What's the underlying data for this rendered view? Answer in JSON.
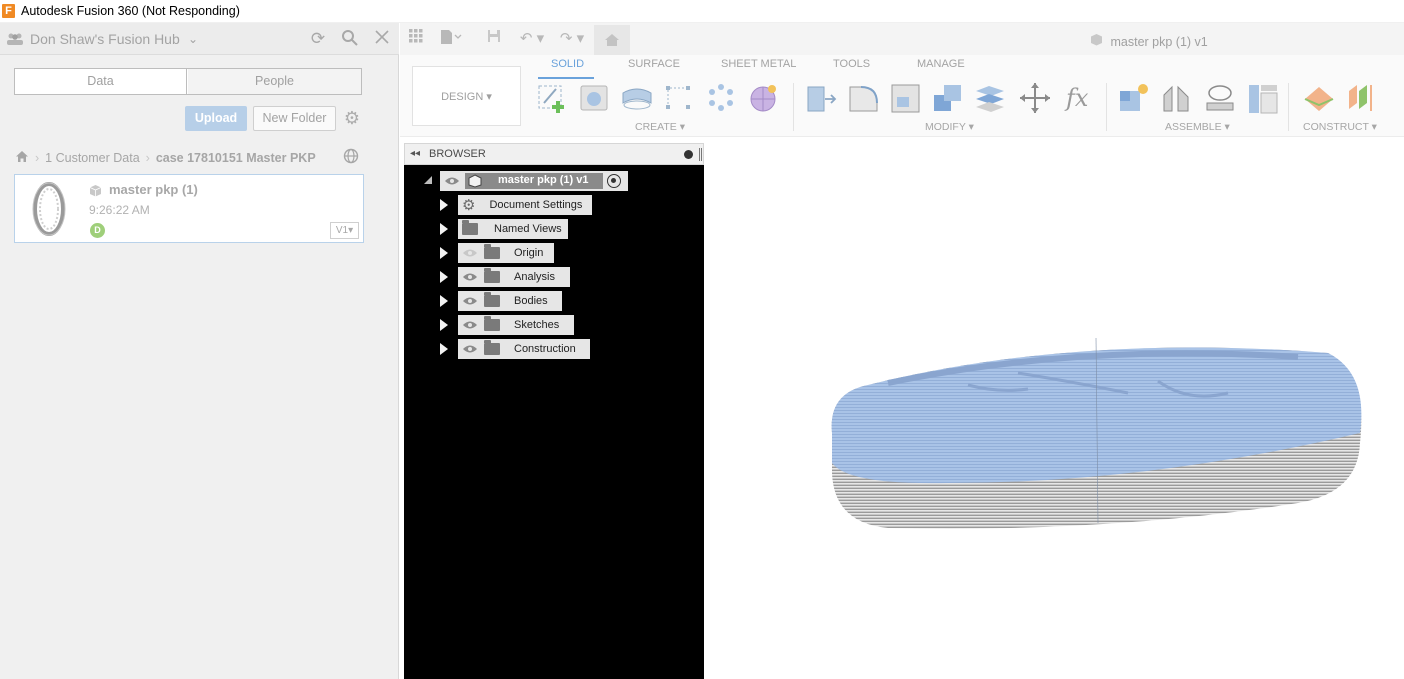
{
  "window": {
    "title": "Autodesk Fusion 360 (Not Responding)"
  },
  "data_panel": {
    "hub_name": "Don Shaw's Fusion Hub",
    "tabs": [
      {
        "label": "Data"
      },
      {
        "label": "People"
      }
    ],
    "upload_label": "Upload",
    "new_folder_label": "New Folder",
    "breadcrumb": [
      "1 Customer Data",
      "case 17810151 Master PKP"
    ],
    "files": [
      {
        "name": "master pkp (1)",
        "time": "9:26:22 AM",
        "avatar": "D",
        "version": "V1"
      }
    ]
  },
  "document": {
    "title": "master pkp (1) v1"
  },
  "toolbar": {
    "workspace": "DESIGN",
    "tabs": [
      "SOLID",
      "SURFACE",
      "SHEET METAL",
      "TOOLS",
      "MANAGE"
    ],
    "active_tab": "SOLID",
    "groups": [
      "CREATE",
      "MODIFY",
      "ASSEMBLE",
      "CONSTRUCT"
    ]
  },
  "browser": {
    "header": "BROWSER",
    "root": "master pkp (1) v1",
    "items": [
      {
        "label": "Document Settings",
        "icon": "gear-icon"
      },
      {
        "label": "Named Views",
        "icon": "folder-icon"
      },
      {
        "label": "Origin",
        "icon": "folder-icon"
      },
      {
        "label": "Analysis",
        "icon": "folder-icon"
      },
      {
        "label": "Bodies",
        "icon": "folder-icon"
      },
      {
        "label": "Sketches",
        "icon": "folder-icon"
      },
      {
        "label": "Construction",
        "icon": "folder-icon"
      }
    ]
  },
  "colors": {
    "accent": "#6aa2db",
    "upload_button": "#b7cfe8",
    "avatar": "#9fcf7a",
    "model_top": "#a7c1e6"
  }
}
